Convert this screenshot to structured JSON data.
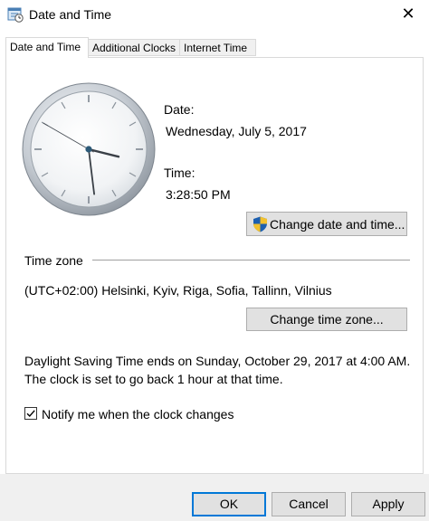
{
  "window": {
    "title": "Date and Time",
    "close_glyph": "✕"
  },
  "tabs": [
    {
      "label": "Date and Time",
      "active": true
    },
    {
      "label": "Additional Clocks",
      "active": false
    },
    {
      "label": "Internet Time",
      "active": false
    }
  ],
  "date_section": {
    "date_label": "Date:",
    "date_value": "Wednesday, July 5, 2017",
    "time_label": "Time:",
    "time_value": "3:28:50 PM",
    "change_datetime_button": "Change date and time..."
  },
  "timezone_section": {
    "heading": "Time zone",
    "value": "(UTC+02:00) Helsinki, Kyiv, Riga, Sofia, Tallinn, Vilnius",
    "change_timezone_button": "Change time zone..."
  },
  "dst": {
    "line1": "Daylight Saving Time ends on Sunday, October 29, 2017 at 4:00 AM.",
    "line2": "The clock is set to go back 1 hour at that time."
  },
  "notify": {
    "label": "Notify me when the clock changes",
    "checked": true
  },
  "footer": {
    "ok": "OK",
    "cancel": "Cancel",
    "apply": "Apply"
  },
  "clock": {
    "hour": 15,
    "minute": 28,
    "second": 50
  },
  "icons": {
    "app": "calendar-clock-icon",
    "shield": "uac-shield-icon",
    "close": "close-icon",
    "check": "checkmark-icon"
  }
}
